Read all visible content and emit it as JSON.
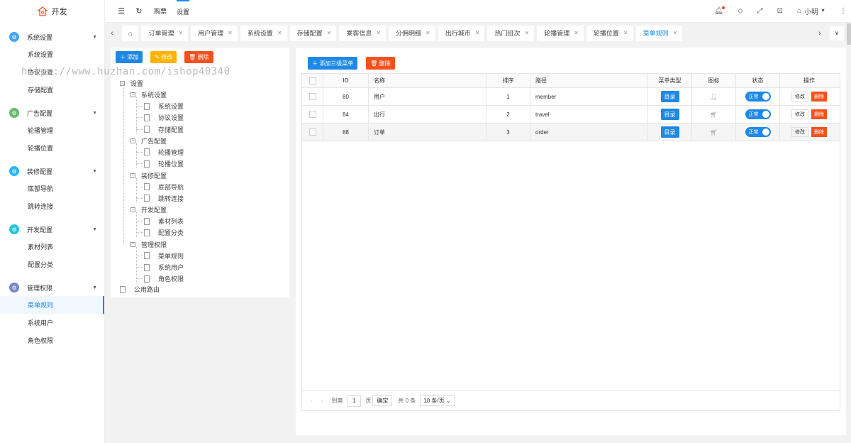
{
  "app": {
    "title": "开发"
  },
  "sidebar": {
    "groups": [
      {
        "label": "系统设置",
        "color": "#42a5f5",
        "items": [
          "系统设置",
          "协议设置",
          "存储配置"
        ]
      },
      {
        "label": "广告配置",
        "color": "#66bb6a",
        "items": [
          "轮播管理",
          "轮播位置"
        ]
      },
      {
        "label": "装修配置",
        "color": "#29b6f6",
        "items": [
          "底部导航",
          "跳转连接"
        ]
      },
      {
        "label": "开发配置",
        "color": "#26c6da",
        "items": [
          "素材列表",
          "配置分类"
        ]
      },
      {
        "label": "管理权限",
        "color": "#7986cb",
        "items": [
          "菜单规则",
          "系统用户",
          "角色权限"
        ]
      }
    ],
    "active": "菜单规则"
  },
  "topbar": {
    "nav": [
      "购票",
      "设置"
    ],
    "user": "小明"
  },
  "tabs": [
    "订单管理",
    "用户管理",
    "系统设置",
    "存储配置",
    "乘客信息",
    "分佣明细",
    "出行城市",
    "热门班次",
    "轮播管理",
    "轮播位置",
    "菜单规则"
  ],
  "tree": {
    "buttons": {
      "add": "添加",
      "edit": "修改",
      "del": "删除"
    },
    "root": "设置",
    "groups": [
      {
        "label": "系统设置",
        "children": [
          "系统设置",
          "协议设置",
          "存储配置"
        ]
      },
      {
        "label": "广告配置",
        "children": [
          "轮播管理",
          "轮播位置"
        ]
      },
      {
        "label": "装修配置",
        "children": [
          "底部导航",
          "跳转连接"
        ]
      },
      {
        "label": "开发配置",
        "children": [
          "素材列表",
          "配置分类"
        ]
      },
      {
        "label": "管理权限",
        "children": [
          "菜单规则",
          "系统用户",
          "角色权限"
        ]
      }
    ],
    "extra": "公用路由"
  },
  "table": {
    "add_btn": "添加三级菜单",
    "del_btn": "删除",
    "headers": [
      "ID",
      "名称",
      "排序",
      "路径",
      "菜单类型",
      "图标",
      "状态",
      "操作"
    ],
    "rows": [
      {
        "id": "80",
        "name": "用户",
        "sort": "1",
        "path": "member",
        "type": "目录",
        "icon": "user-icon",
        "status": "正常"
      },
      {
        "id": "84",
        "name": "出行",
        "sort": "2",
        "path": "travel",
        "type": "目录",
        "icon": "cart-icon",
        "status": "正常"
      },
      {
        "id": "88",
        "name": "订单",
        "sort": "3",
        "path": "order",
        "type": "目录",
        "icon": "cart-icon",
        "status": "正常"
      }
    ],
    "edit": "修改",
    "delete": "删除"
  },
  "pager": {
    "goto": "到第",
    "page": "1",
    "page_unit": "页",
    "confirm": "确定",
    "total": "共 0 条",
    "size": "10 条/页"
  },
  "watermark": "https://www.huzhan.com/ishop40340"
}
